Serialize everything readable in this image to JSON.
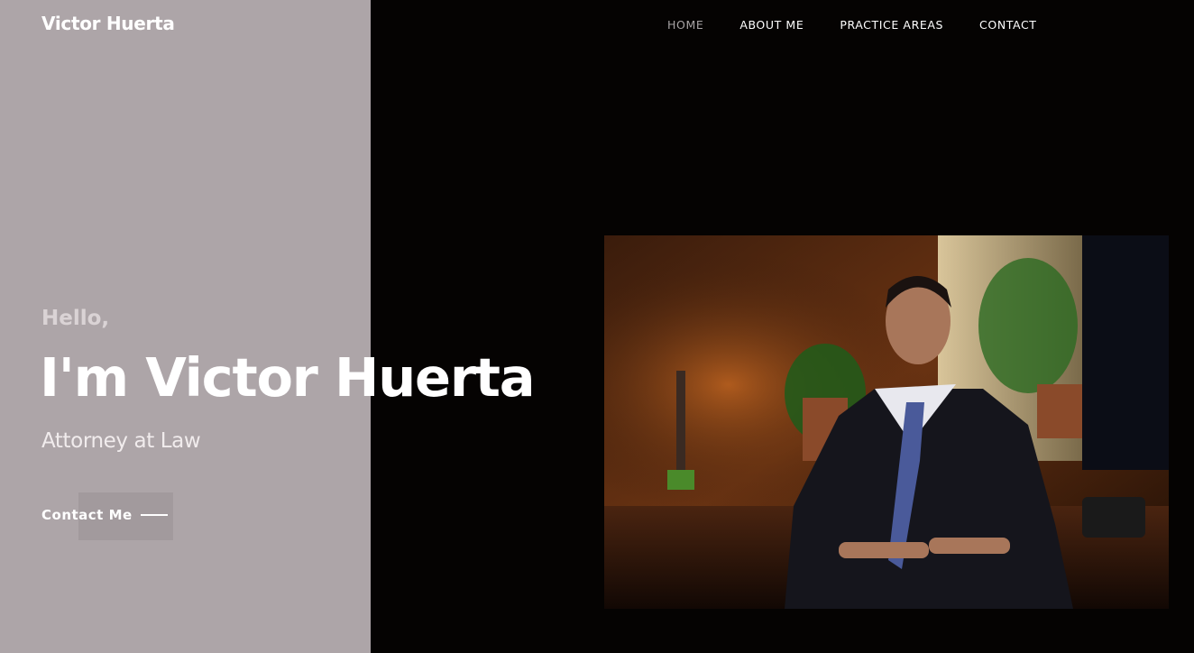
{
  "header": {
    "logo": "Victor Huerta",
    "nav": [
      {
        "label": "HOME",
        "active": true
      },
      {
        "label": "ABOUT ME",
        "active": false
      },
      {
        "label": "PRACTICE AREAS",
        "active": false
      },
      {
        "label": "CONTACT",
        "active": false
      }
    ]
  },
  "hero": {
    "greeting": "Hello,",
    "name": "I'm Victor Huerta",
    "role": "Attorney at Law",
    "cta_label": "Contact Me"
  },
  "colors": {
    "left_panel": "#ada5a8",
    "page_background": "#050302",
    "nav_active": "#a7a3a4",
    "text": "#ffffff"
  },
  "icons": [
    "arrow-line-icon"
  ]
}
